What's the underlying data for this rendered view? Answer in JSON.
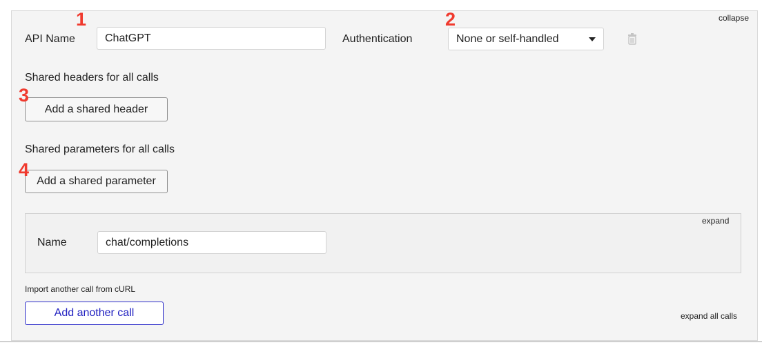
{
  "header": {
    "collapse_label": "collapse"
  },
  "api": {
    "name_label": "API Name",
    "name_value": "ChatGPT",
    "auth_label": "Authentication",
    "auth_value": "None or self-handled"
  },
  "shared_headers": {
    "title": "Shared headers for all calls",
    "button_label": "Add a shared header"
  },
  "shared_params": {
    "title": "Shared parameters for all calls",
    "button_label": "Add a shared parameter"
  },
  "call": {
    "expand_label": "expand",
    "name_label": "Name",
    "name_value": "chat/completions"
  },
  "footer": {
    "import_label": "Import another call from cURL",
    "add_call_label": "Add another call",
    "expand_all_label": "expand all calls"
  },
  "markers": [
    "1",
    "2",
    "3",
    "4"
  ],
  "colors": {
    "marker": "#f03a2e",
    "primary": "#2020c0"
  },
  "icons": {
    "delete": "trash-icon",
    "dropdown": "chevron-down-icon"
  }
}
